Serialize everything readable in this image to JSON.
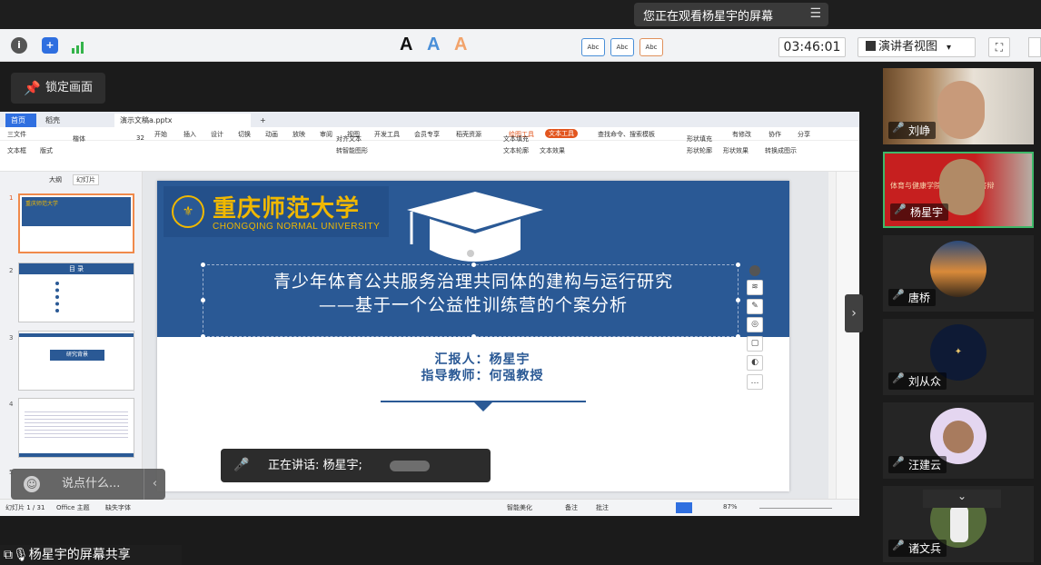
{
  "banner": {
    "watching_text": "您正在观看杨星宇的屏幕",
    "menu_icon": "list-icon"
  },
  "toolbar": {
    "timer": "03:46:01",
    "view_label": "演讲者视图",
    "fullscreen_icon": "fullscreen-icon"
  },
  "lock_button": {
    "label": "锁定画面"
  },
  "wps": {
    "tabs": [
      "首页",
      "稻壳",
      "演示文稿a.pptx",
      "+"
    ],
    "ribbon_menu": [
      "三文件",
      "开始",
      "插入",
      "设计",
      "切换",
      "动画",
      "放映",
      "审阅",
      "视图",
      "开发工具",
      "会员专享",
      "稻壳资源",
      "绘图工具",
      "文本工具",
      "查找命令、搜索模板",
      "有修改",
      "协作",
      "分享"
    ],
    "ribbon_controls": {
      "new_slide": "文本框",
      "layout": "版式",
      "font": "楷体",
      "font_size": "32",
      "text_fill": "文本填充",
      "text_outline": "文本轮廓",
      "text_effects": "文本效果",
      "shape_fill": "形状填充",
      "shape_outline": "形状轮廓",
      "shape_effects": "形状效果",
      "convert": "转换成图示",
      "align_text": "对齐文本",
      "smartart": "转智能图形",
      "abc": "Abc"
    },
    "panel_tabs": [
      "大纲",
      "幻灯片"
    ],
    "thumbnails": [
      {
        "num": "1",
        "title": "重庆师范大学"
      },
      {
        "num": "2",
        "title": "目 录"
      },
      {
        "num": "3",
        "title": "研究背景"
      },
      {
        "num": "4",
        "title": ""
      },
      {
        "num": "5",
        "title": ""
      }
    ],
    "status": {
      "slide_count": "幻灯片 1 / 31",
      "theme": "Office 主题",
      "missing_font": "缺失字体",
      "smart_beautify": "智能美化",
      "notes": "备注",
      "comments": "批注",
      "zoom": "87%"
    }
  },
  "slide": {
    "logo_cn": "重庆师范大学",
    "logo_en": "CHONGQING NORMAL UNIVERSITY",
    "title_line1": "青少年体育公共服务治理共同体的建构与运行研究",
    "title_line2": "——基于一个公益性训练营的个案分析",
    "reporter": "汇报人：杨星宇",
    "advisor": "指导教师：何强教授"
  },
  "speaking_toast": {
    "text": "正在讲话: 杨星宇;"
  },
  "chat_input": {
    "placeholder": "说点什么..."
  },
  "share_caption": {
    "text": "杨星宇的屏幕共享"
  },
  "participants": [
    {
      "name": "刘峥",
      "mic": "on"
    },
    {
      "name": "杨星宇",
      "mic": "on",
      "banner_text": "体育与健康学院 硕士研究生答辩"
    },
    {
      "name": "唐桥",
      "mic": "off"
    },
    {
      "name": "刘从众",
      "mic": "off"
    },
    {
      "name": "汪建云",
      "mic": "off"
    },
    {
      "name": "诸文兵",
      "mic": "off"
    }
  ],
  "colors": {
    "slide_blue": "#2a5995",
    "logo_gold": "#f0b800",
    "active_tile_border": "#3fb96a"
  }
}
